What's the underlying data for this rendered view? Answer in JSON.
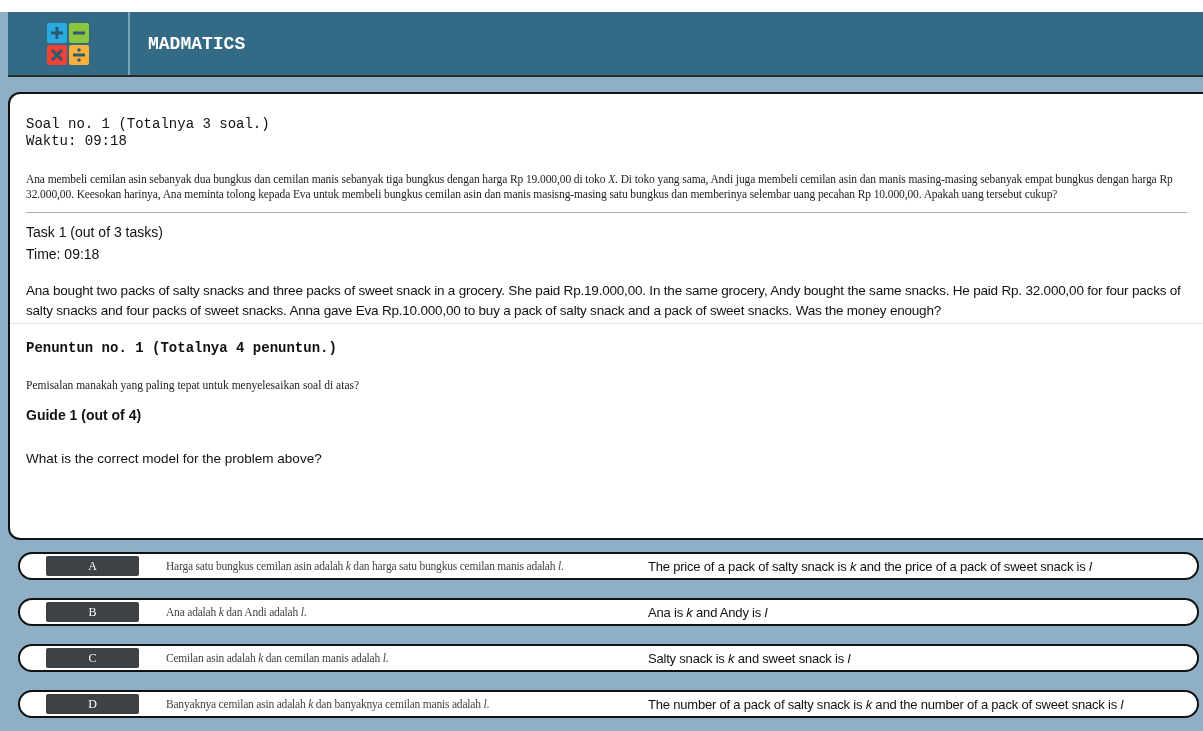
{
  "header": {
    "title": "MADMATICS"
  },
  "question": {
    "heading_id": "Soal no. 1 (Totalnya 3 soal.)",
    "timer_id": "Waktu: 09:18",
    "text_id": "Ana membeli cemilan asin sebanyak dua bungkus dan cemilan manis sebanyak tiga bungkus dengan harga Rp 19.000,00 di toko *X*. Di toko yang sama, Andi juga membeli cemilan asin dan manis masing-masing sebanyak empat bungkus dengan harga Rp 32.000,00. Keesokan harinya, Ana meminta tolong kepada Eva untuk membeli bungkus cemilan asin dan manis masisng-masing satu bungkus dan memberinya selembar uang pecahan Rp 10.000,00. Apakah uang tersebut cukup?",
    "heading_en": "Task 1 (out of 3 tasks)",
    "timer_en": "Time: 09:18",
    "text_en": "Ana bought two packs of salty snacks and three packs of sweet snack in a grocery. She paid Rp.19.000,00. In the same grocery, Andy bought the same snacks. He paid Rp. 32.000,00 for four packs of salty snacks and four packs of sweet snacks. Anna gave Eva Rp.10.000,00 to buy a pack of salty snack and a pack of sweet snacks. Was the money enough?"
  },
  "guide": {
    "heading_id": "Penuntun no. 1 (Totalnya 4 penuntun.)",
    "text_id": "Pemisalan manakah yang paling tepat untuk menyelesaikan soal di atas?",
    "heading_en": "Guide 1 (out of 4)",
    "text_en": "What is the correct model for the problem above?"
  },
  "options": [
    {
      "letter": "A",
      "text_id": "Harga satu bungkus cemilan asin adalah *k* dan harga satu bungkus cemilan manis adalah *l*.",
      "text_en": "The price of a pack of salty snack is *k* and the price of a pack of sweet snack is *l*"
    },
    {
      "letter": "B",
      "text_id": "Ana adalah *k* dan Andi adalah *l*.",
      "text_en": "Ana is *k* and Andy is *l*"
    },
    {
      "letter": "C",
      "text_id": "Cemilan asin adalah *k* dan cemilan manis adalah *l*.",
      "text_en": "Salty snack is *k* and sweet snack is *l*"
    },
    {
      "letter": "D",
      "text_id": "Banyaknya cemilan asin adalah *k* dan banyaknya cemilan manis adalah *l*.",
      "text_en": "The number of a pack of salty snack is *k* and the number of a pack of sweet snack is *l*"
    }
  ]
}
